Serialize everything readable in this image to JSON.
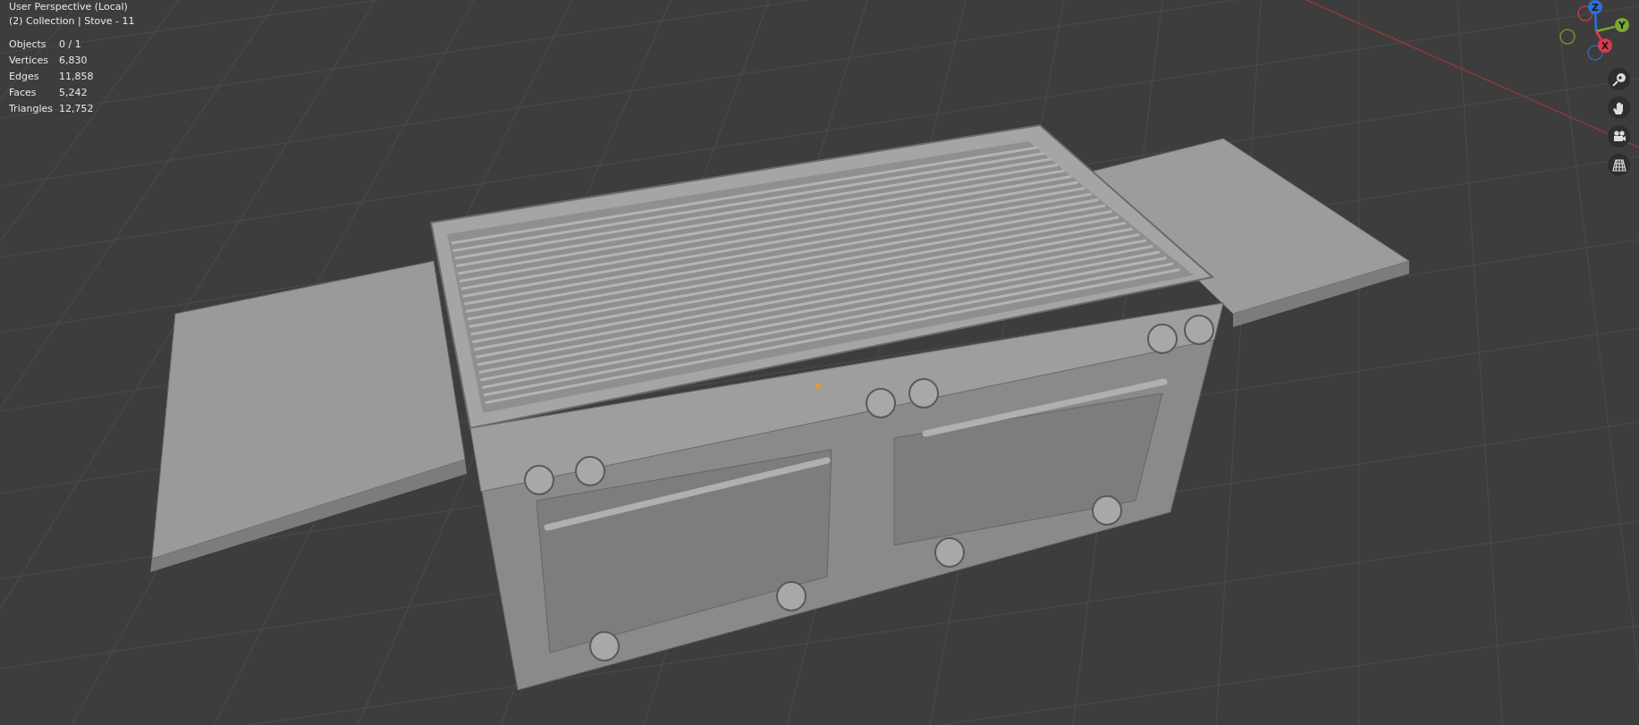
{
  "viewport": {
    "header": [
      "User Perspective (Local)",
      "(2) Collection | Stove - 11"
    ]
  },
  "stats": [
    {
      "label": "Objects",
      "value": "0 / 1"
    },
    {
      "label": "Vertices",
      "value": "6,830"
    },
    {
      "label": "Edges",
      "value": "11,858"
    },
    {
      "label": "Faces",
      "value": "5,242"
    },
    {
      "label": "Triangles",
      "value": "12,752"
    }
  ],
  "gizmo": {
    "axes": [
      {
        "label": "Z",
        "color": "#2f6fd6"
      },
      {
        "label": "Y",
        "color": "#7aa830"
      },
      {
        "label": "X",
        "color": "#e0394f"
      }
    ]
  },
  "nav_tools": [
    {
      "kind": "zoom"
    },
    {
      "kind": "pan"
    },
    {
      "kind": "camera"
    },
    {
      "kind": "grid"
    }
  ]
}
